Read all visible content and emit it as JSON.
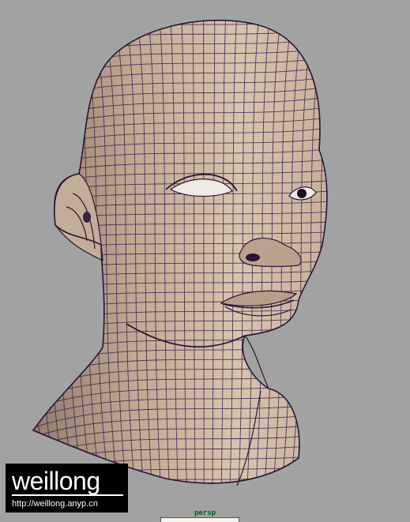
{
  "viewport": {
    "camera": "persp",
    "background_color": "#a2a2a2",
    "mesh_fill_color": "#c9b6a2",
    "mesh_shade_color": "#9c8977",
    "mesh_wire_color": "#3a1f4a",
    "subject_icon": "head-mesh-icon"
  },
  "watermark": {
    "logo": "weillong",
    "url": "http://weillong.anyp.cn"
  }
}
